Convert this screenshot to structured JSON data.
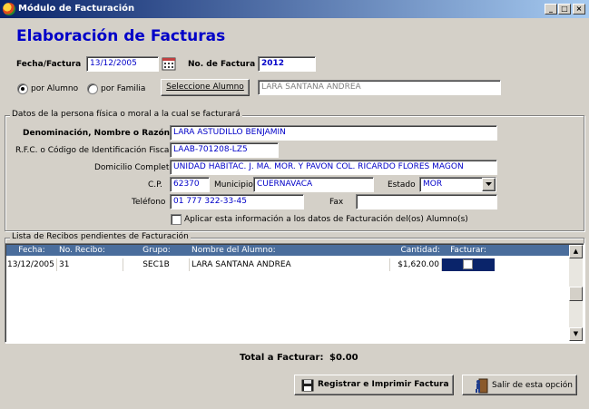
{
  "window": {
    "title": "Módulo de Facturación",
    "minimize": "_",
    "maximize": "□",
    "close": "×"
  },
  "header": {
    "title": "Elaboración de Facturas"
  },
  "top": {
    "fecha_label": "Fecha/Factura",
    "fecha_value": "13/12/2005",
    "numero_label": "No. de Factura",
    "numero_value": "2012",
    "radio_alumno": "por Alumno",
    "radio_familia": "por Familia",
    "seleccione_button": "Seleccione Alumno",
    "alumno_value": "LARA SANTANA ANDREA"
  },
  "persona": {
    "group_title": "Datos de la persona física o moral a la cual se facturará",
    "denominacion_label": "Denominación, Nombre o Razón",
    "denominacion_value": "LARA ASTUDILLO BENJAMIN",
    "rfc_label": "R.F.C. o Código de Identificación Fiscal",
    "rfc_value": "LAAB-701208-LZ5",
    "domicilio_label": "Domicilio Completo",
    "domicilio_value": "UNIDAD HABITAC. J. MA. MOR. Y PAVON COL. RICARDO FLORES MAGON",
    "cp_label": "C.P.",
    "cp_value": "62370",
    "municipio_label": "Municipio",
    "municipio_value": "CUERNAVACA",
    "estado_label": "Estado",
    "estado_value": "MOR",
    "telefono_label": "Teléfono",
    "telefono_value": "01 777 322-33-45",
    "fax_label": "Fax",
    "fax_value": "",
    "aplicar_label": "Aplicar esta información a los datos de Facturación del(os) Alumno(s)"
  },
  "recibos": {
    "group_title": "Lista de Recibos pendientes de Facturación",
    "columns": [
      "Fecha:",
      "No. Recibo:",
      "Grupo:",
      "Nombre del Alumno:",
      "Cantidad:",
      "Facturar:"
    ],
    "rows": [
      {
        "fecha": "13/12/2005",
        "recibo": "31",
        "grupo": "SEC1B",
        "nombre": "LARA SANTANA ANDREA",
        "cantidad": "$1,620.00"
      }
    ]
  },
  "footer": {
    "total_label": "Total a Facturar:",
    "total_value": "$0.00",
    "registrar_button": "Registrar e Imprimir Factura",
    "salir_button": "Salir de esta opción"
  },
  "colors": {
    "title": "#0000c8",
    "field_text": "#0000c8",
    "header_row": "#4a6d9c",
    "selected": "#0a246a"
  }
}
